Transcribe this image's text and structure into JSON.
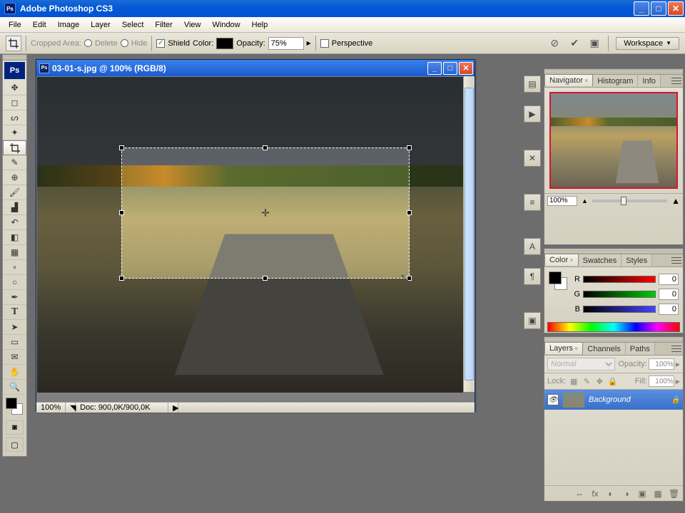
{
  "app": {
    "title": "Adobe Photoshop CS3",
    "icon_label": "Ps"
  },
  "menu": [
    "File",
    "Edit",
    "Image",
    "Layer",
    "Select",
    "Filter",
    "View",
    "Window",
    "Help"
  ],
  "options": {
    "cropped_area_label": "Cropped Area:",
    "delete_label": "Delete",
    "hide_label": "Hide",
    "shield_label": "Shield",
    "color_label": "Color:",
    "opacity_label": "Opacity:",
    "opacity_value": "75%",
    "perspective_label": "Perspective",
    "workspace_label": "Workspace"
  },
  "doc": {
    "title": "03-01-s.jpg @ 100% (RGB/8)",
    "zoom": "100%",
    "doc_size": "Doc: 900,0K/900,0K"
  },
  "navigator": {
    "tabs": [
      "Navigator",
      "Histogram",
      "Info"
    ],
    "zoom_value": "100%"
  },
  "color": {
    "tabs": [
      "Color",
      "Swatches",
      "Styles"
    ],
    "r_label": "R",
    "r_value": "0",
    "g_label": "G",
    "g_value": "0",
    "b_label": "B",
    "b_value": "0"
  },
  "layers": {
    "tabs": [
      "Layers",
      "Channels",
      "Paths"
    ],
    "blend_mode": "Normal",
    "opacity_label": "Opacity:",
    "opacity_value": "100%",
    "lock_label": "Lock:",
    "fill_label": "Fill:",
    "fill_value": "100%",
    "bg_layer": "Background"
  }
}
